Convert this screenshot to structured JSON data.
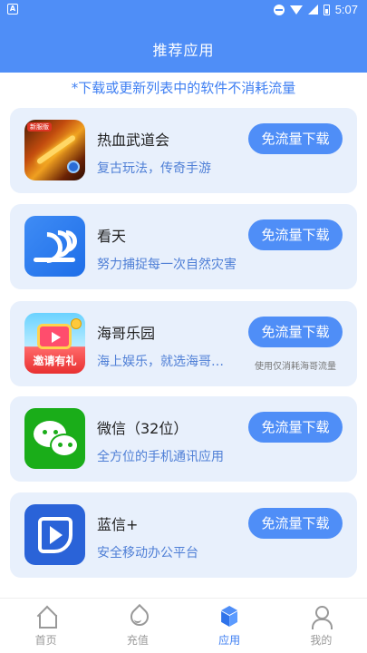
{
  "status_bar": {
    "time": "5:07",
    "notification_letter": "A"
  },
  "header": {
    "title": "推荐应用"
  },
  "notice": "*下载或更新列表中的软件不消耗流量",
  "apps": [
    {
      "name": "热血武道会",
      "desc": "复古玩法，传奇手游",
      "button": "免流量下载",
      "icon": "game-warrior-icon",
      "icon_badge": "新服版"
    },
    {
      "name": "看天",
      "desc": "努力捕捉每一次自然灾害",
      "button": "免流量下载",
      "icon": "weather-wave-icon"
    },
    {
      "name": "海哥乐园",
      "desc": "海上娱乐，就选海哥乐园",
      "button": "免流量下载",
      "note": "使用仅消耗海哥流量",
      "icon": "tv-gift-icon",
      "icon_text": "邀请有礼"
    },
    {
      "name": "微信（32位）",
      "desc": "全方位的手机通讯应用",
      "button": "免流量下载",
      "icon": "wechat-icon"
    },
    {
      "name": "蓝信+",
      "desc": "安全移动办公平台",
      "button": "免流量下载",
      "icon": "lanxin-icon"
    }
  ],
  "bottom_nav": [
    {
      "label": "首页",
      "icon": "home-icon",
      "active": false
    },
    {
      "label": "充值",
      "icon": "drop-icon",
      "active": false
    },
    {
      "label": "应用",
      "icon": "cube-icon",
      "active": true
    },
    {
      "label": "我的",
      "icon": "user-icon",
      "active": false
    }
  ],
  "colors": {
    "primary": "#4f8ef7",
    "card_bg": "#e8f0fc",
    "desc_text": "#4f7fd6"
  }
}
